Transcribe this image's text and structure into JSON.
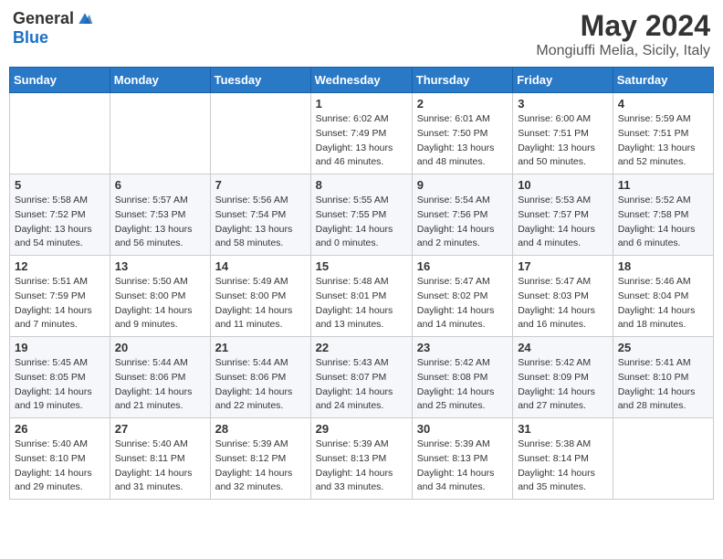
{
  "header": {
    "logo_general": "General",
    "logo_blue": "Blue",
    "month_title": "May 2024",
    "location": "Mongiuffi Melia, Sicily, Italy"
  },
  "calendar": {
    "days_of_week": [
      "Sunday",
      "Monday",
      "Tuesday",
      "Wednesday",
      "Thursday",
      "Friday",
      "Saturday"
    ],
    "weeks": [
      [
        {
          "day": "",
          "info": ""
        },
        {
          "day": "",
          "info": ""
        },
        {
          "day": "",
          "info": ""
        },
        {
          "day": "1",
          "info": "Sunrise: 6:02 AM\nSunset: 7:49 PM\nDaylight: 13 hours\nand 46 minutes."
        },
        {
          "day": "2",
          "info": "Sunrise: 6:01 AM\nSunset: 7:50 PM\nDaylight: 13 hours\nand 48 minutes."
        },
        {
          "day": "3",
          "info": "Sunrise: 6:00 AM\nSunset: 7:51 PM\nDaylight: 13 hours\nand 50 minutes."
        },
        {
          "day": "4",
          "info": "Sunrise: 5:59 AM\nSunset: 7:51 PM\nDaylight: 13 hours\nand 52 minutes."
        }
      ],
      [
        {
          "day": "5",
          "info": "Sunrise: 5:58 AM\nSunset: 7:52 PM\nDaylight: 13 hours\nand 54 minutes."
        },
        {
          "day": "6",
          "info": "Sunrise: 5:57 AM\nSunset: 7:53 PM\nDaylight: 13 hours\nand 56 minutes."
        },
        {
          "day": "7",
          "info": "Sunrise: 5:56 AM\nSunset: 7:54 PM\nDaylight: 13 hours\nand 58 minutes."
        },
        {
          "day": "8",
          "info": "Sunrise: 5:55 AM\nSunset: 7:55 PM\nDaylight: 14 hours\nand 0 minutes."
        },
        {
          "day": "9",
          "info": "Sunrise: 5:54 AM\nSunset: 7:56 PM\nDaylight: 14 hours\nand 2 minutes."
        },
        {
          "day": "10",
          "info": "Sunrise: 5:53 AM\nSunset: 7:57 PM\nDaylight: 14 hours\nand 4 minutes."
        },
        {
          "day": "11",
          "info": "Sunrise: 5:52 AM\nSunset: 7:58 PM\nDaylight: 14 hours\nand 6 minutes."
        }
      ],
      [
        {
          "day": "12",
          "info": "Sunrise: 5:51 AM\nSunset: 7:59 PM\nDaylight: 14 hours\nand 7 minutes."
        },
        {
          "day": "13",
          "info": "Sunrise: 5:50 AM\nSunset: 8:00 PM\nDaylight: 14 hours\nand 9 minutes."
        },
        {
          "day": "14",
          "info": "Sunrise: 5:49 AM\nSunset: 8:00 PM\nDaylight: 14 hours\nand 11 minutes."
        },
        {
          "day": "15",
          "info": "Sunrise: 5:48 AM\nSunset: 8:01 PM\nDaylight: 14 hours\nand 13 minutes."
        },
        {
          "day": "16",
          "info": "Sunrise: 5:47 AM\nSunset: 8:02 PM\nDaylight: 14 hours\nand 14 minutes."
        },
        {
          "day": "17",
          "info": "Sunrise: 5:47 AM\nSunset: 8:03 PM\nDaylight: 14 hours\nand 16 minutes."
        },
        {
          "day": "18",
          "info": "Sunrise: 5:46 AM\nSunset: 8:04 PM\nDaylight: 14 hours\nand 18 minutes."
        }
      ],
      [
        {
          "day": "19",
          "info": "Sunrise: 5:45 AM\nSunset: 8:05 PM\nDaylight: 14 hours\nand 19 minutes."
        },
        {
          "day": "20",
          "info": "Sunrise: 5:44 AM\nSunset: 8:06 PM\nDaylight: 14 hours\nand 21 minutes."
        },
        {
          "day": "21",
          "info": "Sunrise: 5:44 AM\nSunset: 8:06 PM\nDaylight: 14 hours\nand 22 minutes."
        },
        {
          "day": "22",
          "info": "Sunrise: 5:43 AM\nSunset: 8:07 PM\nDaylight: 14 hours\nand 24 minutes."
        },
        {
          "day": "23",
          "info": "Sunrise: 5:42 AM\nSunset: 8:08 PM\nDaylight: 14 hours\nand 25 minutes."
        },
        {
          "day": "24",
          "info": "Sunrise: 5:42 AM\nSunset: 8:09 PM\nDaylight: 14 hours\nand 27 minutes."
        },
        {
          "day": "25",
          "info": "Sunrise: 5:41 AM\nSunset: 8:10 PM\nDaylight: 14 hours\nand 28 minutes."
        }
      ],
      [
        {
          "day": "26",
          "info": "Sunrise: 5:40 AM\nSunset: 8:10 PM\nDaylight: 14 hours\nand 29 minutes."
        },
        {
          "day": "27",
          "info": "Sunrise: 5:40 AM\nSunset: 8:11 PM\nDaylight: 14 hours\nand 31 minutes."
        },
        {
          "day": "28",
          "info": "Sunrise: 5:39 AM\nSunset: 8:12 PM\nDaylight: 14 hours\nand 32 minutes."
        },
        {
          "day": "29",
          "info": "Sunrise: 5:39 AM\nSunset: 8:13 PM\nDaylight: 14 hours\nand 33 minutes."
        },
        {
          "day": "30",
          "info": "Sunrise: 5:39 AM\nSunset: 8:13 PM\nDaylight: 14 hours\nand 34 minutes."
        },
        {
          "day": "31",
          "info": "Sunrise: 5:38 AM\nSunset: 8:14 PM\nDaylight: 14 hours\nand 35 minutes."
        },
        {
          "day": "",
          "info": ""
        }
      ]
    ]
  }
}
